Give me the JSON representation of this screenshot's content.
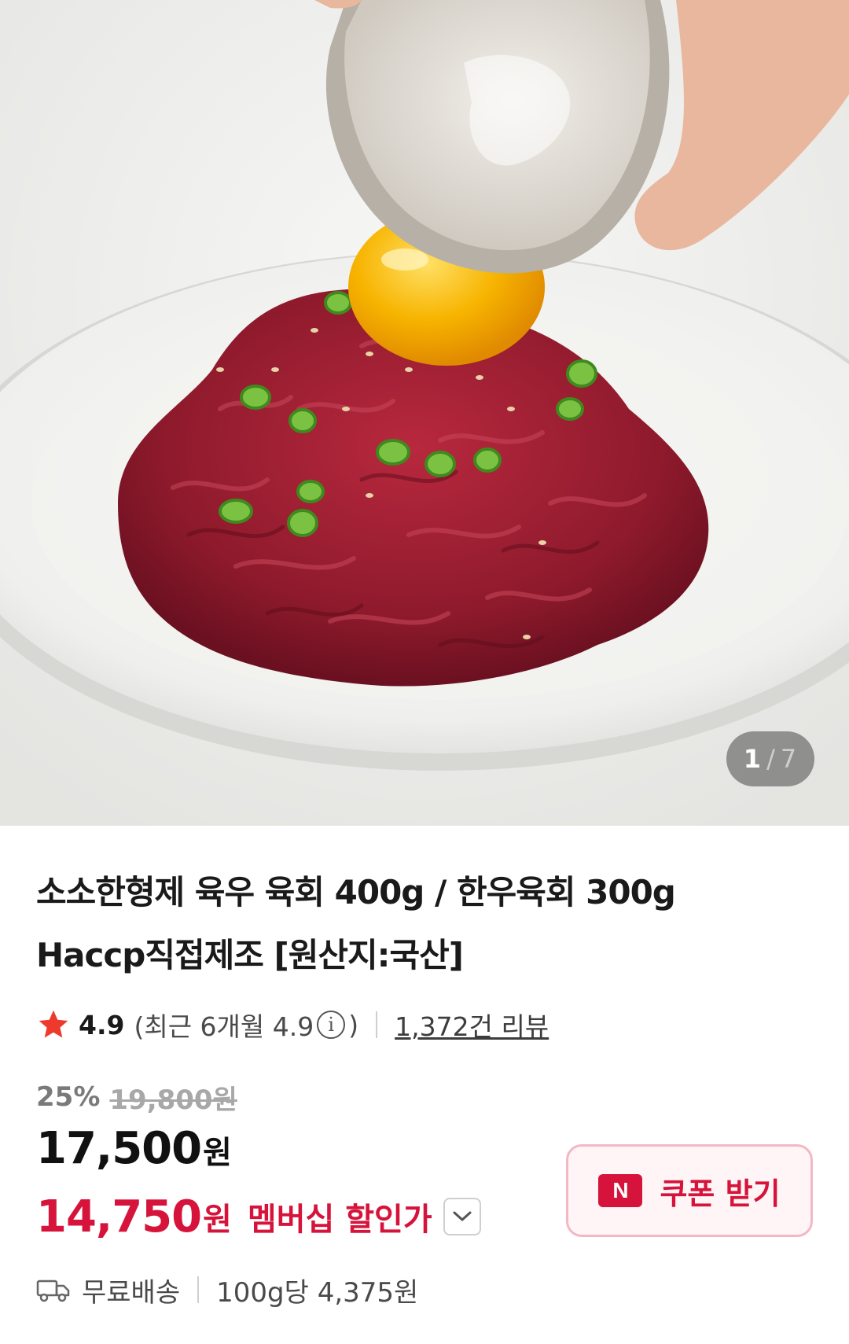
{
  "hero": {
    "image_alt": "육회 위에 노른자를 올리는 모습",
    "counter_current": "1",
    "counter_separator": "/",
    "counter_total": "7"
  },
  "product": {
    "title_line1": "소소한형제 육우 육회 400g / 한우육회 300g",
    "title_line2": "Haccp직접제조 [원산지:국산]"
  },
  "rating": {
    "score": "4.9",
    "recent_prefix": "(최근 6개월 4.9",
    "recent_suffix": ")",
    "info_symbol": "i",
    "review_count": "1,372건 리뷰"
  },
  "price": {
    "discount_rate": "25%",
    "original_price": "19,800원",
    "sale_price": "17,500",
    "currency": "원",
    "member_price": "14,750",
    "member_currency": "원",
    "member_label": "멤버십 할인가"
  },
  "coupon": {
    "logo_text": "N",
    "label": "쿠폰 받기"
  },
  "shipping": {
    "label": "무료배송",
    "unit_price": "100g당 4,375원"
  },
  "colors": {
    "accent": "#d6143b",
    "coupon_bg": "#fff5f7",
    "star": "#ee3a2c"
  },
  "icons": [
    "star-icon",
    "info-icon",
    "chevron-down-icon",
    "truck-icon",
    "n-pay-logo"
  ]
}
